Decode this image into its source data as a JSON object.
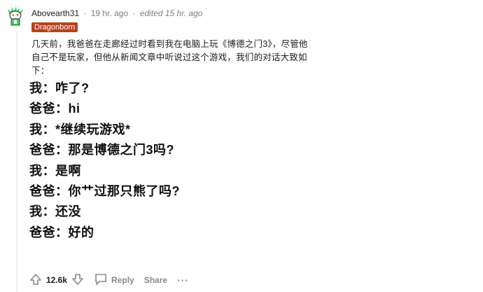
{
  "comment": {
    "author": "Abovearth31",
    "separator": "·",
    "time_ago": "19 hr. ago",
    "edited": "edited 15 hr. ago",
    "flair": "Dragonborn",
    "body": "几天前，我爸爸在走廊经过时看到我在电脑上玩《博德之门3》，尽管他自己不是玩家，但他从新闻文章中听说过这个游戏，我们的对话大致如下：",
    "dialogue": [
      "我：咋了?",
      "爸爸：hi",
      "我：*继续玩游戏*",
      "爸爸：那是博德之门3吗?",
      "我：是啊",
      "爸爸：你艹过那只熊了吗?",
      "我：还没",
      "爸爸：好的"
    ]
  },
  "actions": {
    "score": "12.6k",
    "reply_label": "Reply",
    "share_label": "Share",
    "more_label": "···"
  },
  "icons": {
    "avatar": "snoo-green-avatar-icon",
    "upvote": "upvote-arrow-icon",
    "downvote": "downvote-arrow-icon",
    "reply": "speech-bubble-icon"
  },
  "colors": {
    "flair_bg": "#b8421b",
    "meta_text": "#7c7c7c",
    "action_text": "#878a8c",
    "thread_line": "#edeff1"
  }
}
